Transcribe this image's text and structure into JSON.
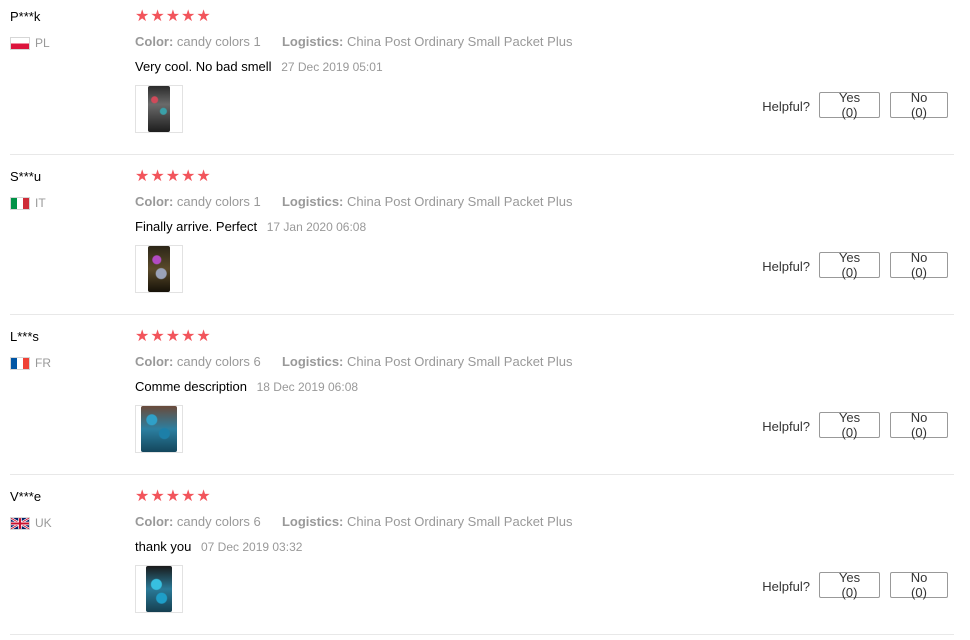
{
  "reviews": [
    {
      "user": "P***k",
      "country_code": "PL",
      "flag_icon": "poland-flag-icon",
      "rating": 5,
      "color_label": "Color:",
      "color_value": "candy colors 1",
      "logistics_label": "Logistics:",
      "logistics_value": "China Post Ordinary Small Packet Plus",
      "text": "Very cool. No bad smell",
      "date": "27 Dec 2019 05:01",
      "helpful_label": "Helpful?",
      "yes_label": "Yes (0)",
      "no_label": "No (0)"
    },
    {
      "user": "S***u",
      "country_code": "IT",
      "flag_icon": "italy-flag-icon",
      "rating": 5,
      "color_label": "Color:",
      "color_value": "candy colors 1",
      "logistics_label": "Logistics:",
      "logistics_value": "China Post Ordinary Small Packet Plus",
      "text": "Finally arrive. Perfect",
      "date": "17 Jan 2020 06:08",
      "helpful_label": "Helpful?",
      "yes_label": "Yes (0)",
      "no_label": "No (0)"
    },
    {
      "user": "L***s",
      "country_code": "FR",
      "flag_icon": "france-flag-icon",
      "rating": 5,
      "color_label": "Color:",
      "color_value": "candy colors 6",
      "logistics_label": "Logistics:",
      "logistics_value": "China Post Ordinary Small Packet Plus",
      "text": "Comme description",
      "date": "18 Dec 2019 06:08",
      "helpful_label": "Helpful?",
      "yes_label": "Yes (0)",
      "no_label": "No (0)"
    },
    {
      "user": "V***e",
      "country_code": "UK",
      "flag_icon": "uk-flag-icon",
      "rating": 5,
      "color_label": "Color:",
      "color_value": "candy colors 6",
      "logistics_label": "Logistics:",
      "logistics_value": "China Post Ordinary Small Packet Plus",
      "text": "thank you",
      "date": "07 Dec 2019 03:32",
      "helpful_label": "Helpful?",
      "yes_label": "Yes (0)",
      "no_label": "No (0)"
    }
  ],
  "star_glyph": "★",
  "colors": {
    "star": "#f2545b",
    "muted_text": "#999999",
    "divider": "#e8e8e8"
  }
}
